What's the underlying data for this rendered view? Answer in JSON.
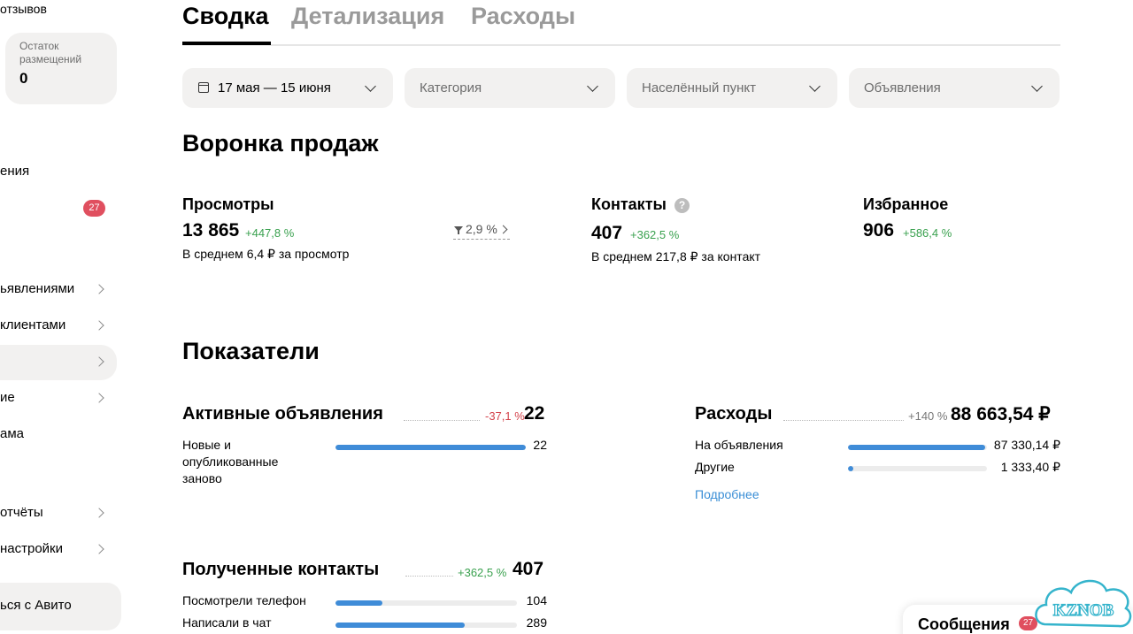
{
  "sidebar": {
    "reviews_text": "отзывов",
    "balance_label": "Остаток размещений",
    "balance_value": "0",
    "items": [
      {
        "label": "ения"
      },
      {
        "label": ""
      },
      {
        "label": "ьявлениями"
      },
      {
        "label": "клиентами"
      },
      {
        "label": ""
      },
      {
        "label": "ие"
      },
      {
        "label": "ама"
      },
      {
        "label": "отчёты"
      },
      {
        "label": "настройки"
      }
    ],
    "badge": "27",
    "bottom_button": "ься с Авито"
  },
  "tabs": [
    {
      "label": "Сводка",
      "active": true
    },
    {
      "label": "Детализация",
      "active": false
    },
    {
      "label": "Расходы",
      "active": false
    }
  ],
  "filters": {
    "date": "17 мая — 15 июня",
    "category": "Категория",
    "locality": "Населённый пункт",
    "ads": "Объявления"
  },
  "funnel": {
    "title": "Воронка продаж",
    "views": {
      "label": "Просмотры",
      "value": "13 865",
      "delta": "+447,8 %",
      "sub": "В среднем 6,4 ₽ за просмотр",
      "conversion": "2,9 %"
    },
    "contacts": {
      "label": "Контакты",
      "value": "407",
      "delta": "+362,5 %",
      "sub": "В среднем 217,8 ₽ за контакт",
      "help": "?"
    },
    "favorites": {
      "label": "Избранное",
      "value": "906",
      "delta": "+586,4 %"
    }
  },
  "indicators": {
    "title": "Показатели",
    "active_ads": {
      "title": "Активные объявления",
      "delta": "-37,1 %",
      "value": "22",
      "rows": [
        {
          "label": "Новые и опубликованные заново",
          "value": "22",
          "fraction": 1.0
        }
      ]
    },
    "expenses": {
      "title": "Расходы",
      "delta": "+140 %",
      "value": "88 663,54 ₽",
      "rows": [
        {
          "label": "На объявления",
          "value": "87 330,14 ₽",
          "fraction": 0.985
        },
        {
          "label": "Другие",
          "value": "1 333,40 ₽",
          "fraction": 0.04
        }
      ],
      "more_link": "Подробнее"
    },
    "received_contacts": {
      "title": "Полученные контакты",
      "delta": "+362,5 %",
      "value": "407",
      "rows": [
        {
          "label": "Посмотрели телефон",
          "value": "104",
          "fraction": 0.26
        },
        {
          "label": "Написали в чат",
          "value": "289",
          "fraction": 0.71
        }
      ]
    }
  },
  "messages": {
    "label": "Сообщения",
    "badge": "27"
  },
  "watermark": {
    "text": "KZNOB"
  },
  "colors": {
    "accent": "#3f8cd8",
    "positive": "#3aa14f",
    "negative": "#d4434b",
    "badge": "#e04f5f",
    "panel": "#f2f1f0"
  }
}
